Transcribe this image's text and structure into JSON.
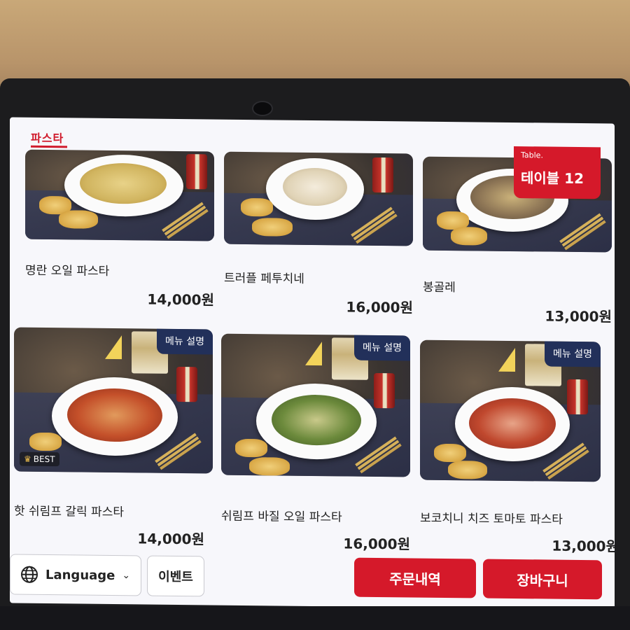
{
  "category": "파스타",
  "table": {
    "small": "Table.",
    "label": "테이블 12"
  },
  "menu_badge": "메뉴 설명",
  "best_badge": "BEST",
  "items": [
    {
      "name": "명란 오일 파스타",
      "price": "14,000원"
    },
    {
      "name": "트러플 페투치네",
      "price": "16,000원"
    },
    {
      "name": "봉골레",
      "price": "13,000원"
    },
    {
      "name": "핫 쉬림프 갈릭 파스타",
      "price": "14,000원"
    },
    {
      "name": "쉬림프 바질 오일 파스타",
      "price": "16,000원"
    },
    {
      "name": "보코치니 치즈 토마토 파스타",
      "price": "13,000원"
    }
  ],
  "footer": {
    "language": "Language",
    "event": "이벤트",
    "order_history": "주문내역",
    "cart": "장바구니"
  },
  "colors": {
    "accent": "#d5192a",
    "badge_navy": "#22305a"
  }
}
